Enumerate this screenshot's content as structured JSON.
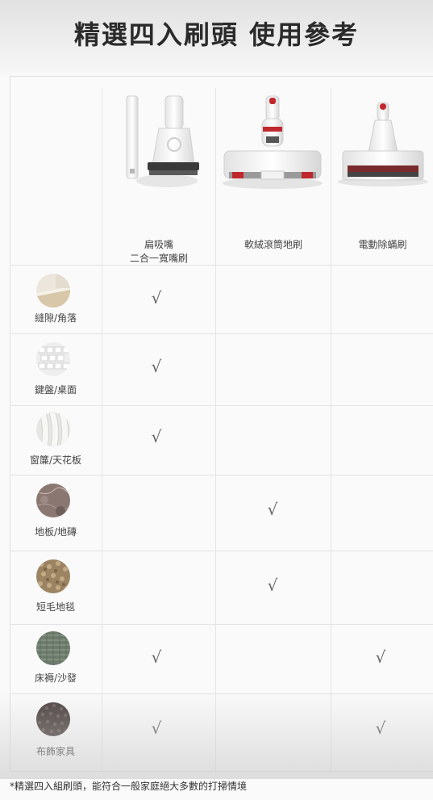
{
  "title": "精選四入刷頭 使用參考",
  "brushes": [
    {
      "label": "扁吸嘴\n二合一寬嘴刷",
      "icon": "crevice-and-wide-brush-icon"
    },
    {
      "label": "軟絨滾筒地刷",
      "icon": "soft-roller-floor-brush-icon"
    },
    {
      "label": "電動除蟎刷",
      "icon": "electric-mite-brush-icon"
    }
  ],
  "rows": [
    {
      "label": "縫隙/角落",
      "icon": "corner-gap-icon",
      "checks": [
        true,
        false,
        false
      ]
    },
    {
      "label": "鍵盤/桌面",
      "icon": "keyboard-icon",
      "checks": [
        true,
        false,
        false
      ]
    },
    {
      "label": "窗簾/天花板",
      "icon": "curtain-icon",
      "checks": [
        true,
        false,
        false
      ]
    },
    {
      "label": "地板/地磚",
      "icon": "marble-floor-icon",
      "checks": [
        false,
        true,
        false
      ]
    },
    {
      "label": "短毛地毯",
      "icon": "short-carpet-icon",
      "checks": [
        false,
        true,
        false
      ]
    },
    {
      "label": "床褥/沙發",
      "icon": "mattress-sofa-icon",
      "checks": [
        true,
        false,
        true
      ]
    },
    {
      "label": "布飾家具",
      "icon": "fabric-furniture-icon",
      "checks": [
        true,
        false,
        true
      ]
    }
  ],
  "check_mark": "√",
  "footnote": "*精選四入組刷頭，能符合一般家庭絕大多數的打掃情境"
}
